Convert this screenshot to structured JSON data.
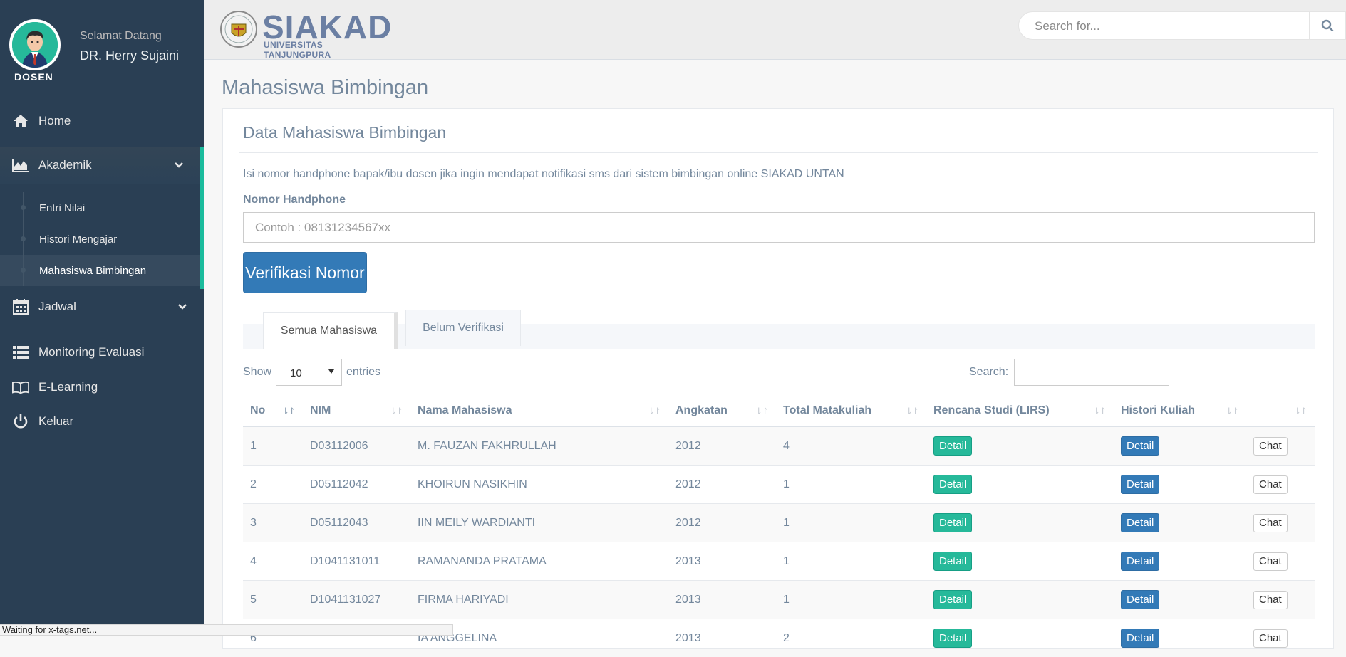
{
  "profile": {
    "welcome": "Selamat Datang",
    "name": "DR. Herry Sujaini",
    "role": "DOSEN"
  },
  "sidebar": {
    "items": [
      {
        "label": "Home",
        "icon": "home-icon"
      },
      {
        "label": "Akademik",
        "icon": "area-chart-icon"
      },
      {
        "label": "Jadwal",
        "icon": "calendar-icon"
      },
      {
        "label": "Monitoring Evaluasi",
        "icon": "list-icon"
      },
      {
        "label": "E-Learning",
        "icon": "book-icon"
      },
      {
        "label": "Keluar",
        "icon": "power-icon"
      }
    ],
    "akademik_sub": [
      "Entri Nilai",
      "Histori Mengajar",
      "Mahasiswa Bimbingan"
    ]
  },
  "topnav": {
    "logo_title": "SIAKAD",
    "logo_subtitle": "UNIVERSITAS TANJUNGPURA",
    "search_placeholder": "Search for..."
  },
  "page": {
    "title": "Mahasiswa Bimbingan",
    "panel_title": "Data Mahasiswa Bimbingan",
    "info": "Isi nomor handphone bapak/ibu dosen jika ingin mendapat notifikasi sms dari sistem bimbingan online SIAKAD UNTAN",
    "hp_label": "Nomor Handphone",
    "hp_placeholder": "Contoh : 08131234567xx",
    "verify_button": "Verifikasi Nomor",
    "tabs": [
      "Semua Mahasiswa",
      "Belum Verifikasi"
    ]
  },
  "table_controls": {
    "show": "Show",
    "entries_value": "10",
    "entries": "entries",
    "search": "Search:"
  },
  "table": {
    "headers": [
      "No",
      "NIM",
      "Nama Mahasiswa",
      "Angkatan",
      "Total Matakuliah",
      "Rencana Studi (LIRS)",
      "Histori Kuliah",
      ""
    ],
    "detail_label": "Detail",
    "chat_label": "Chat",
    "rows": [
      {
        "no": "1",
        "nim": "D03112006",
        "nama": "M. FAUZAN FAKHRULLAH",
        "angkatan": "2012",
        "total": "4"
      },
      {
        "no": "2",
        "nim": "D05112042",
        "nama": "KHOIRUN NASIKHIN",
        "angkatan": "2012",
        "total": "1"
      },
      {
        "no": "3",
        "nim": "D05112043",
        "nama": "IIN MEILY WARDIANTI",
        "angkatan": "2012",
        "total": "1"
      },
      {
        "no": "4",
        "nim": "D1041131011",
        "nama": "RAMANANDA PRATAMA",
        "angkatan": "2013",
        "total": "1"
      },
      {
        "no": "5",
        "nim": "D1041131027",
        "nama": "FIRMA HARIYADI",
        "angkatan": "2013",
        "total": "1"
      },
      {
        "no": "6",
        "nim": "",
        "nama": "IA ANGGELINA",
        "angkatan": "2013",
        "total": "2"
      }
    ]
  },
  "status_bar": "Waiting for x-tags.net..."
}
